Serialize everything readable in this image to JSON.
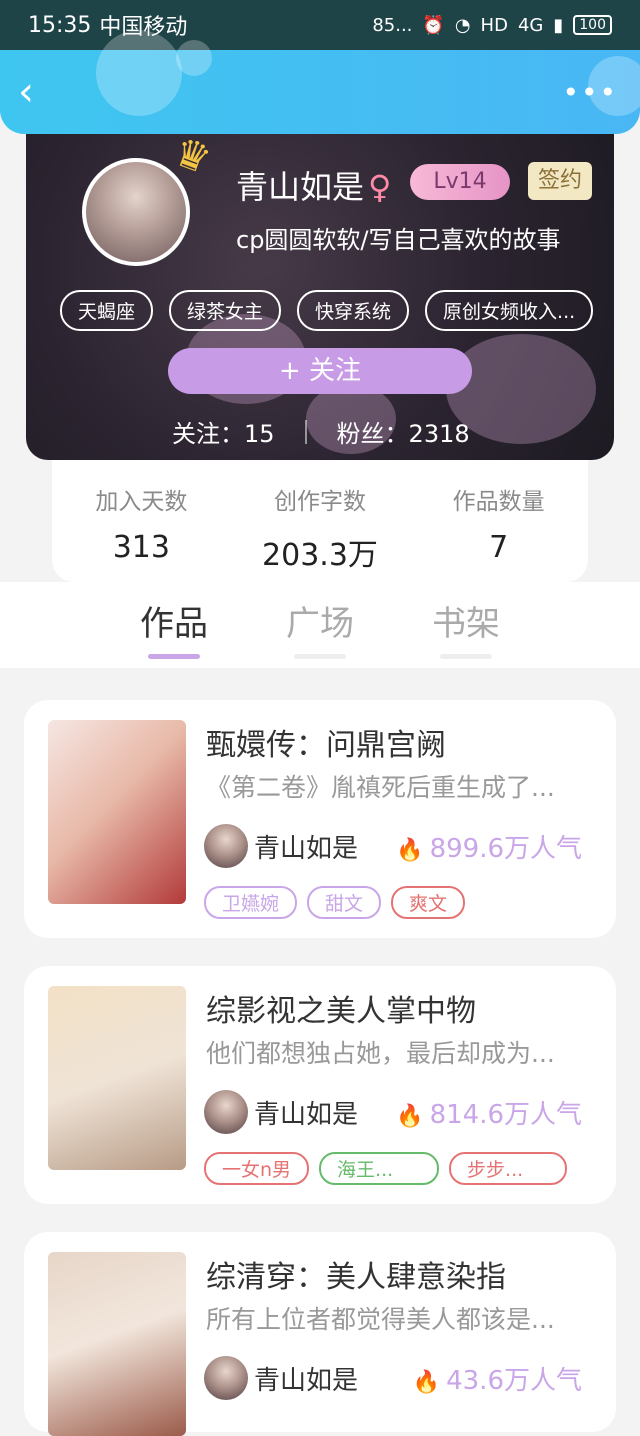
{
  "status_bar": {
    "time": "15:35",
    "carrier": "中国移动",
    "speed": "85...",
    "hd": "HD",
    "network": "4G",
    "battery": "100"
  },
  "header": {
    "back_icon": "chevron-left-icon",
    "more_icon": "more-dots-icon",
    "accent": "#49b7f4"
  },
  "profile": {
    "username": "青山如是",
    "gender_symbol": "♀",
    "level": "Lv14",
    "sign_label": "签约",
    "bio": "cp圆圆软软/写自己喜欢的故事",
    "tags": [
      "天蝎座",
      "绿茶女主",
      "快穿系统",
      "原创女频收入..."
    ],
    "follow_label": "+  关注",
    "following_text": "关注：15",
    "fans_text": "粉丝：2318"
  },
  "stats": [
    {
      "label": "加入天数",
      "value": "313"
    },
    {
      "label": "创作字数",
      "value": "203.3万"
    },
    {
      "label": "作品数量",
      "value": "7"
    }
  ],
  "tabs": [
    {
      "label": "作品",
      "active": true
    },
    {
      "label": "广场",
      "active": false
    },
    {
      "label": "书架",
      "active": false
    }
  ],
  "books": [
    {
      "title": "甄嬛传：问鼎宫阙",
      "desc": "《第二卷》胤禛死后重生成了...",
      "author": "青山如是",
      "popularity": "899.6万人气",
      "tags": [
        {
          "label": "卫嬿婉",
          "color": "#c9a6e8"
        },
        {
          "label": "甜文",
          "color": "#c9a6e8"
        },
        {
          "label": "爽文",
          "color": "#e57373"
        }
      ]
    },
    {
      "title": "综影视之美人掌中物",
      "desc": "他们都想独占她，最后却成为...",
      "author": "青山如是",
      "popularity": "814.6万人气",
      "tags": [
        {
          "label": "一女n男",
          "color": "#e57373"
        },
        {
          "label": "海王...",
          "color": "#66bb6a"
        },
        {
          "label": "步步...",
          "color": "#e57373"
        }
      ]
    },
    {
      "title": "综清穿：美人肆意染指",
      "desc": "所有上位者都觉得美人都该是...",
      "author": "青山如是",
      "popularity": "43.6万人气",
      "tags": []
    }
  ]
}
